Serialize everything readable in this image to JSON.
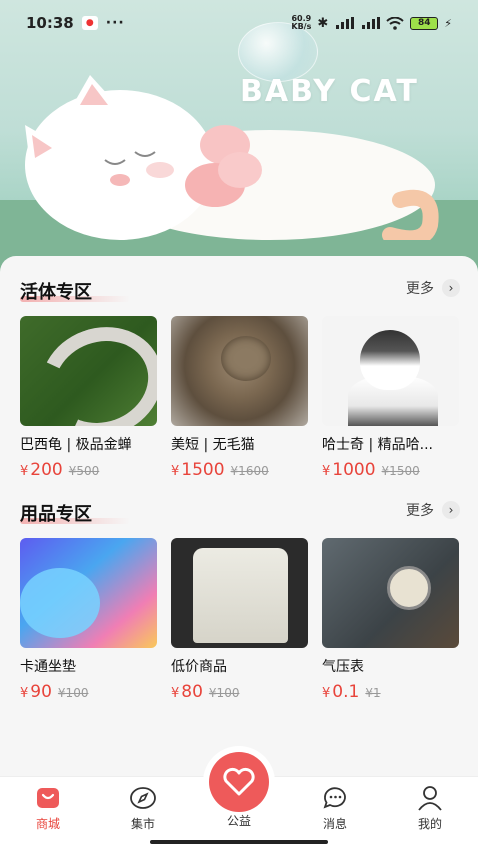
{
  "status_bar": {
    "time": "10:38",
    "dots": "···",
    "speed": "60.9\nKB/s",
    "battery": "84"
  },
  "hero": {
    "brand_text": "BABY CAT"
  },
  "sections": [
    {
      "title": "活体专区",
      "more_label": "更多",
      "items": [
        {
          "name": "巴西龟 | 极品金蝉",
          "price": "200",
          "original": "¥500",
          "image": "silkworm-photo"
        },
        {
          "name": "美短 | 无毛猫",
          "price": "1500",
          "original": "¥1600",
          "image": "tabby-cat-photo"
        },
        {
          "name": "哈士奇 | 精品哈...",
          "price": "1000",
          "original": "¥1500",
          "image": "husky-photo"
        }
      ]
    },
    {
      "title": "用品专区",
      "more_label": "更多",
      "items": [
        {
          "name": "卡通坐垫",
          "price": "90",
          "original": "¥100",
          "image": "abstract-cushion-photo"
        },
        {
          "name": "低价商品",
          "price": "80",
          "original": "¥100",
          "image": "jacket-photo"
        },
        {
          "name": "气压表",
          "price": "0.1",
          "original": "¥1",
          "image": "pressure-gauge-photo"
        }
      ]
    }
  ],
  "currency_symbol": "¥",
  "nav": {
    "items": [
      {
        "label": "商城",
        "icon": "shop-bag-icon",
        "active": true
      },
      {
        "label": "集市",
        "icon": "compass-icon",
        "active": false
      },
      {
        "label": "公益",
        "icon": "heart-icon",
        "active": false
      },
      {
        "label": "消息",
        "icon": "chat-bubble-icon",
        "active": false
      },
      {
        "label": "我的",
        "icon": "person-icon",
        "active": false
      }
    ]
  },
  "colors": {
    "accent": "#e8443b",
    "fab": "#ee5a5a"
  }
}
